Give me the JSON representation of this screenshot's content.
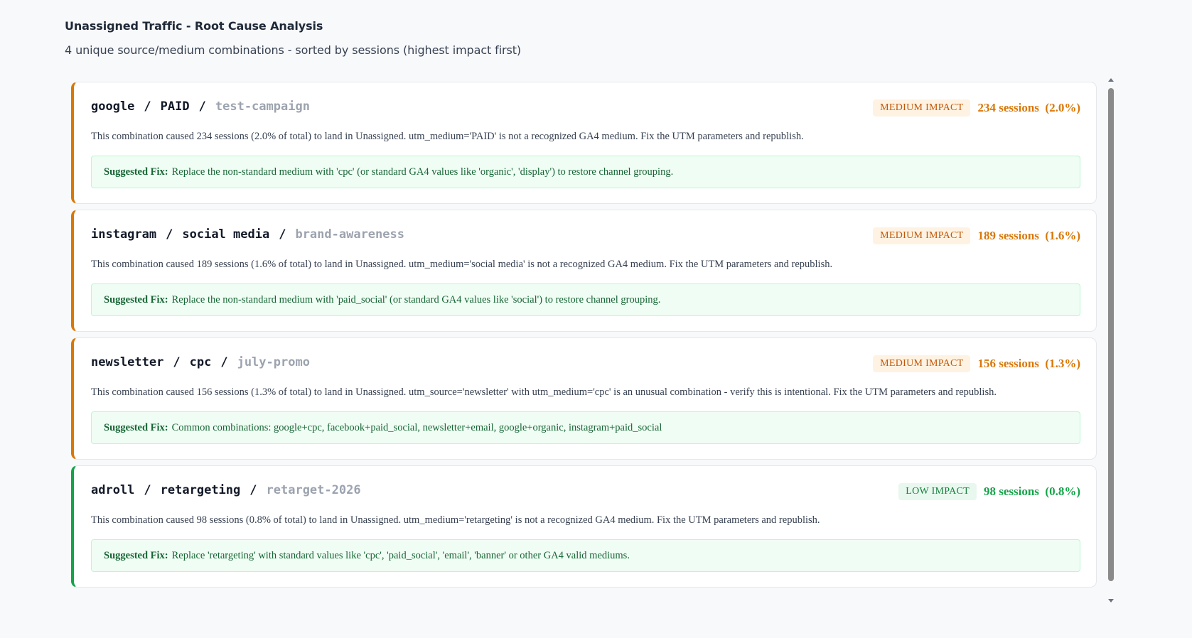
{
  "header": {
    "title": "Unassigned Traffic - Root Cause Analysis",
    "subtitle": "4 unique source/medium combinations - sorted by sessions (highest impact first)"
  },
  "colors": {
    "medium": "#d97706",
    "low": "#16a34a"
  },
  "fix_label": "Suggested Fix:",
  "cards": [
    {
      "source": "google",
      "medium": "PAID",
      "campaign": "test-campaign",
      "impact": "MEDIUM IMPACT",
      "impact_level": "medium",
      "sessions": "234 sessions  (2.0%)",
      "description": "This combination caused 234 sessions (2.0% of total) to land in Unassigned. utm_medium='PAID' is not a recognized GA4 medium. Fix the UTM parameters and republish.",
      "fix": "Replace the non-standard medium with 'cpc' (or standard GA4 values like 'organic', 'display') to restore channel grouping."
    },
    {
      "source": "instagram",
      "medium": "social media",
      "campaign": "brand-awareness",
      "impact": "MEDIUM IMPACT",
      "impact_level": "medium",
      "sessions": "189 sessions  (1.6%)",
      "description": "This combination caused 189 sessions (1.6% of total) to land in Unassigned. utm_medium='social media' is not a recognized GA4 medium. Fix the UTM parameters and republish.",
      "fix": "Replace the non-standard medium with 'paid_social' (or standard GA4 values like 'social') to restore channel grouping."
    },
    {
      "source": "newsletter",
      "medium": "cpc",
      "campaign": "july-promo",
      "impact": "MEDIUM IMPACT",
      "impact_level": "medium",
      "sessions": "156 sessions  (1.3%)",
      "description": "This combination caused 156 sessions (1.3% of total) to land in Unassigned. utm_source='newsletter' with utm_medium='cpc' is an unusual combination - verify this is intentional. Fix the UTM parameters and republish.",
      "fix": "Common combinations: google+cpc, facebook+paid_social, newsletter+email, google+organic, instagram+paid_social"
    },
    {
      "source": "adroll",
      "medium": "retargeting",
      "campaign": "retarget-2026",
      "impact": "LOW IMPACT",
      "impact_level": "low",
      "sessions": "98 sessions  (0.8%)",
      "description": "This combination caused 98 sessions (0.8% of total) to land in Unassigned. utm_medium='retargeting' is not a recognized GA4 medium. Fix the UTM parameters and republish.",
      "fix": "Replace 'retargeting' with standard values like 'cpc', 'paid_social', 'email', 'banner' or other GA4 valid mediums."
    }
  ]
}
